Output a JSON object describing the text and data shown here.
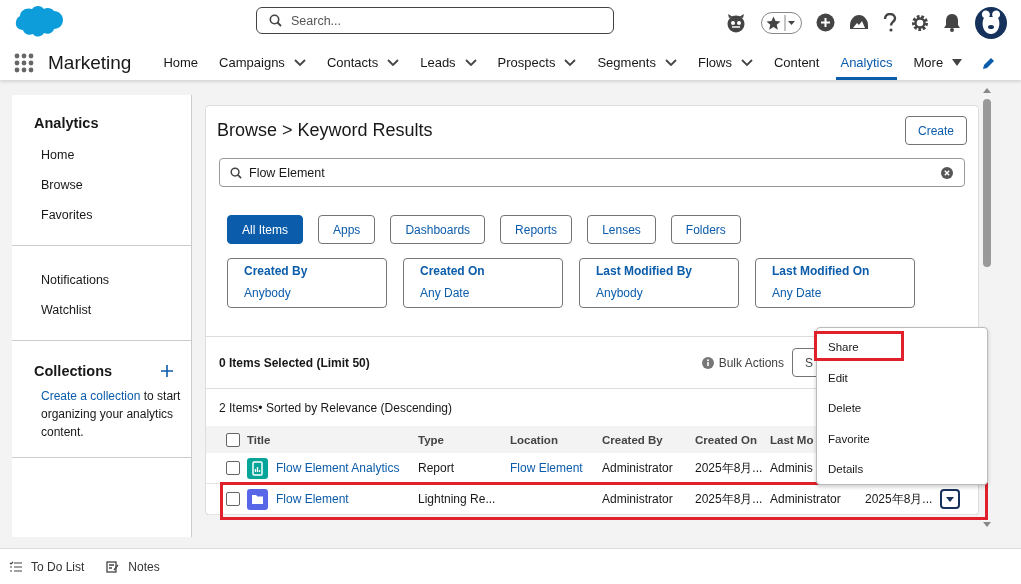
{
  "app": {
    "name": "Marketing"
  },
  "header": {
    "search": {
      "placeholder": "Search..."
    }
  },
  "nav": [
    {
      "label": "Home",
      "has_menu": false,
      "selected": false
    },
    {
      "label": "Campaigns",
      "has_menu": true,
      "selected": false
    },
    {
      "label": "Contacts",
      "has_menu": true,
      "selected": false
    },
    {
      "label": "Leads",
      "has_menu": true,
      "selected": false
    },
    {
      "label": "Prospects",
      "has_menu": true,
      "selected": false
    },
    {
      "label": "Segments",
      "has_menu": true,
      "selected": false
    },
    {
      "label": "Flows",
      "has_menu": true,
      "selected": false
    },
    {
      "label": "Content",
      "has_menu": false,
      "selected": false
    },
    {
      "label": "Analytics",
      "has_menu": false,
      "selected": true
    },
    {
      "label": "More",
      "has_menu": true,
      "selected": false
    }
  ],
  "sidebar": {
    "title": "Analytics",
    "items": [
      "Home",
      "Browse",
      "Favorites"
    ],
    "items2": [
      "Notifications",
      "Watchlist"
    ],
    "collections": {
      "title": "Collections",
      "link": "Create a collection",
      "text": "to start organizing your analytics content."
    }
  },
  "browse": {
    "title": "Browse > Keyword Results",
    "create_button": "Create",
    "search_value": "Flow Element",
    "filters": [
      {
        "label": "All Items",
        "selected": true
      },
      {
        "label": "Apps",
        "selected": false
      },
      {
        "label": "Dashboards",
        "selected": false
      },
      {
        "label": "Reports",
        "selected": false
      },
      {
        "label": "Lenses",
        "selected": false
      },
      {
        "label": "Folders",
        "selected": false
      }
    ],
    "facets": [
      {
        "label": "Created By",
        "value": "Anybody"
      },
      {
        "label": "Created On",
        "value": "Any Date"
      },
      {
        "label": "Last Modified By",
        "value": "Anybody"
      },
      {
        "label": "Last Modified On",
        "value": "Any Date"
      }
    ],
    "selection_text": "0 Items Selected (Limit 50)",
    "bulk_actions": "Bulk Actions",
    "partial_button": "S",
    "summary": "2 Items• Sorted by Relevance (Descending)",
    "table": {
      "select_all_checked": false,
      "columns": [
        "Title",
        "Type",
        "Location",
        "Created By",
        "Created On",
        "Last Mo"
      ],
      "rows": [
        {
          "kind": "report",
          "checked": false,
          "highlighted": false,
          "title": "Flow Element Analytics",
          "type": "Report",
          "location": "Flow Element",
          "created_by": "Administrator",
          "created_on": "2025年8月...",
          "last_modified_by": "Adminis"
        },
        {
          "kind": "folder",
          "checked": false,
          "highlighted": true,
          "title": "Flow Element",
          "type": "Lightning Re...",
          "created_by": "Administrator",
          "created_on": "2025年8月...",
          "last_modified_by": "Administrator",
          "last_modified_on": "2025年8月...",
          "has_action": true
        }
      ]
    }
  },
  "menu": {
    "items": [
      {
        "label": "Share",
        "highlighted": true
      },
      {
        "label": "Edit",
        "highlighted": false
      },
      {
        "label": "Delete",
        "highlighted": false
      },
      {
        "label": "Favorite",
        "highlighted": false
      },
      {
        "label": "Details",
        "highlighted": false
      }
    ]
  },
  "footer": [
    {
      "label": "To Do List",
      "kind": "todo"
    },
    {
      "label": "Notes",
      "kind": "notes"
    }
  ]
}
